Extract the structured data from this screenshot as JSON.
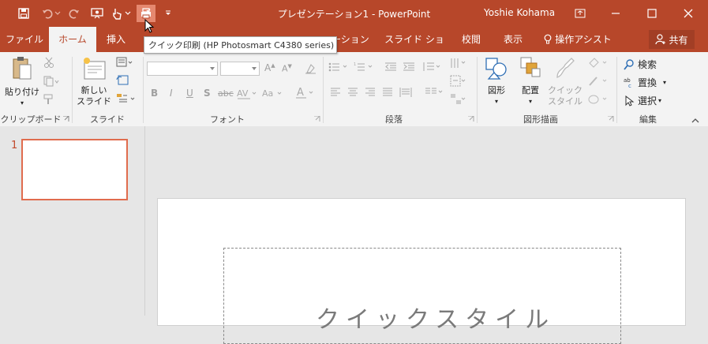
{
  "window": {
    "title": "プレゼンテーション1 - PowerPoint",
    "user": "Yoshie Kohama",
    "share_label": "共有"
  },
  "colors": {
    "accent": "#b7472a",
    "active_tab_bg": "#f3f3f3",
    "ribbon_bg": "#f3f3f3",
    "selection": "#e06c4e"
  },
  "qat": {
    "icons": [
      "save-icon",
      "undo-icon",
      "redo-icon",
      "slideshow-icon",
      "touch-mode-icon",
      "quick-print-icon",
      "customize-qat-icon"
    ]
  },
  "tabs": [
    {
      "label": "ファイル"
    },
    {
      "label": "ホーム"
    },
    {
      "label": "挿入"
    },
    {
      "label": "ーション"
    },
    {
      "label": "スライド ショー"
    },
    {
      "label": "校閲"
    },
    {
      "label": "表示"
    },
    {
      "label": "操作アシスト"
    }
  ],
  "tooltip": "クイック印刷 (HP Photosmart C4380 series)",
  "ribbon": {
    "clipboard": {
      "paste": "貼り付け",
      "label": "クリップボード"
    },
    "slides": {
      "new_slide_line1": "新しい",
      "new_slide_line2": "スライド",
      "label": "スライド"
    },
    "font": {
      "label": "フォント",
      "font_name": "",
      "font_size": "",
      "buttons": [
        "B",
        "I",
        "U",
        "S",
        "abc"
      ]
    },
    "paragraph": {
      "label": "段落"
    },
    "drawing": {
      "label": "図形描画",
      "shapes": "図形",
      "arrange": "配置",
      "quick_style_line1": "クイック",
      "quick_style_line2": "スタイル"
    },
    "editing": {
      "label": "編集",
      "find": "検索",
      "replace": "置換",
      "select": "選択"
    }
  },
  "thumbnails": [
    {
      "number": "1"
    }
  ],
  "slide": {
    "title_placeholder": "クイックスタイル"
  }
}
